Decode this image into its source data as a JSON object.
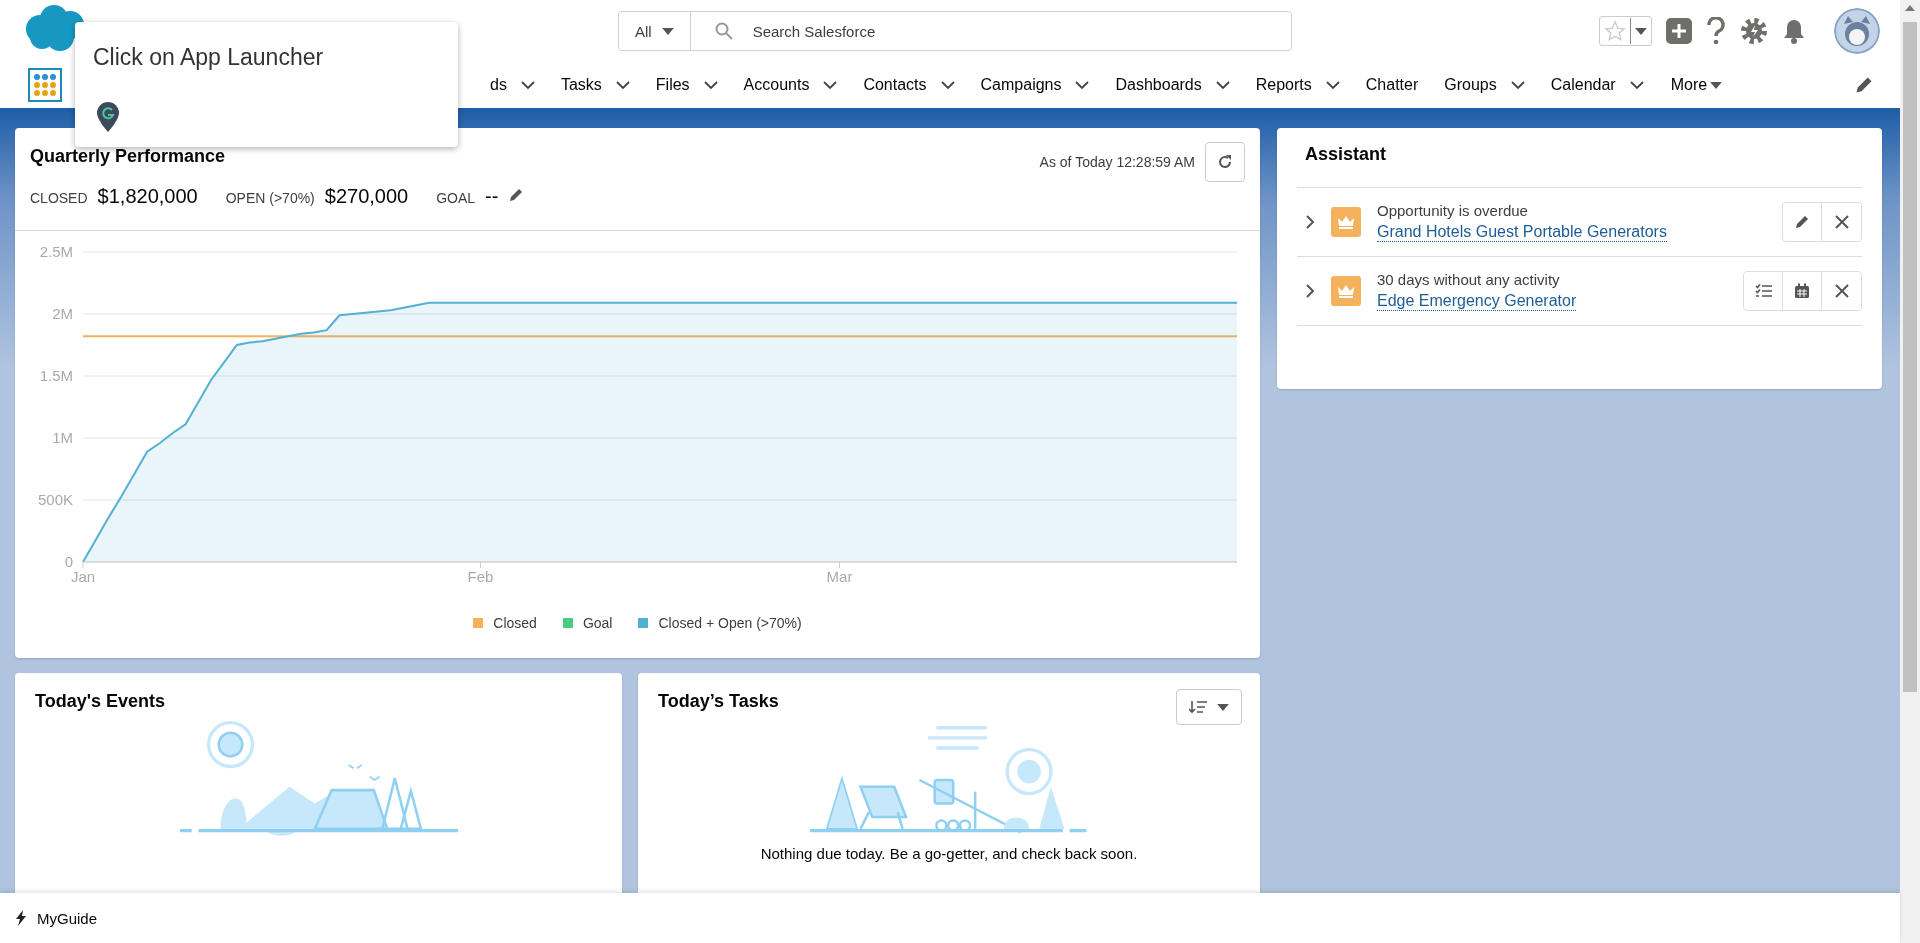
{
  "search": {
    "scope": "All",
    "placeholder": "Search Salesforce"
  },
  "nav": {
    "items": [
      {
        "label": "ds",
        "has_menu": true
      },
      {
        "label": "Tasks",
        "has_menu": true
      },
      {
        "label": "Files",
        "has_menu": true
      },
      {
        "label": "Accounts",
        "has_menu": true
      },
      {
        "label": "Contacts",
        "has_menu": true
      },
      {
        "label": "Campaigns",
        "has_menu": true
      },
      {
        "label": "Dashboards",
        "has_menu": true
      },
      {
        "label": "Reports",
        "has_menu": true
      },
      {
        "label": "Chatter",
        "has_menu": false
      },
      {
        "label": "Groups",
        "has_menu": true
      },
      {
        "label": "Calendar",
        "has_menu": true
      }
    ],
    "more": "More"
  },
  "tooltip": {
    "title": "Click on App Launcher"
  },
  "performance": {
    "title": "Quarterly Performance",
    "as_of": "As of Today 12:28:59 AM",
    "metrics": [
      {
        "label": "CLOSED",
        "value": "$1,820,000",
        "editable": false
      },
      {
        "label": "OPEN (>70%)",
        "value": "$270,000",
        "editable": false
      },
      {
        "label": "GOAL",
        "value": "--",
        "editable": true
      }
    ],
    "chart_data": {
      "type": "area",
      "grid": true,
      "legend": "bottom",
      "categories": [
        "Jan",
        null,
        null,
        null,
        null,
        null,
        null,
        null,
        null,
        null,
        null,
        null,
        null,
        null,
        null,
        null,
        null,
        null,
        null,
        null,
        null,
        null,
        null,
        null,
        null,
        null,
        null,
        null,
        null,
        null,
        null,
        "Feb",
        null,
        null,
        null,
        null,
        null,
        null,
        null,
        null,
        null,
        null,
        null,
        null,
        null,
        null,
        null,
        null,
        null,
        null,
        null,
        null,
        null,
        null,
        null,
        null,
        null,
        null,
        null,
        "Mar",
        null,
        null,
        null,
        null,
        null,
        null,
        null,
        null,
        null,
        null,
        null,
        null,
        null,
        null,
        null,
        null,
        null,
        null,
        null,
        null,
        null,
        null,
        null,
        null,
        null,
        null,
        null,
        null,
        null,
        null,
        null
      ],
      "ylim": [
        0,
        2500000
      ],
      "yticks": [
        {
          "value": 0,
          "label": "0"
        },
        {
          "value": 500000,
          "label": "500K"
        },
        {
          "value": 1000000,
          "label": "1M"
        },
        {
          "value": 1500000,
          "label": "1.5M"
        },
        {
          "value": 2000000,
          "label": "2M"
        },
        {
          "value": 2500000,
          "label": "2.5M"
        }
      ],
      "series": [
        {
          "name": "Closed",
          "type": "line",
          "color": "#f4b25d",
          "values": [
            1820000,
            1820000,
            1820000,
            1820000,
            1820000,
            1820000,
            1820000,
            1820000,
            1820000,
            1820000,
            1820000,
            1820000,
            1820000,
            1820000,
            1820000,
            1820000,
            1820000,
            1820000,
            1820000,
            1820000,
            1820000,
            1820000,
            1820000,
            1820000,
            1820000,
            1820000,
            1820000,
            1820000,
            1820000,
            1820000,
            1820000,
            1820000,
            1820000,
            1820000,
            1820000,
            1820000,
            1820000,
            1820000,
            1820000,
            1820000,
            1820000,
            1820000,
            1820000,
            1820000,
            1820000,
            1820000,
            1820000,
            1820000,
            1820000,
            1820000,
            1820000,
            1820000,
            1820000,
            1820000,
            1820000,
            1820000,
            1820000,
            1820000,
            1820000,
            1820000,
            1820000,
            1820000,
            1820000,
            1820000,
            1820000,
            1820000,
            1820000,
            1820000,
            1820000,
            1820000,
            1820000,
            1820000,
            1820000,
            1820000,
            1820000,
            1820000,
            1820000,
            1820000,
            1820000,
            1820000,
            1820000,
            1820000,
            1820000,
            1820000,
            1820000,
            1820000,
            1820000,
            1820000,
            1820000,
            1820000,
            1820000
          ]
        },
        {
          "name": "Goal",
          "color": "#4bca81",
          "values": [
            null,
            null,
            null,
            null,
            null,
            null,
            null,
            null,
            null,
            null,
            null,
            null,
            null,
            null,
            null,
            null,
            null,
            null,
            null,
            null,
            null,
            null,
            null,
            null,
            null,
            null,
            null,
            null,
            null,
            null,
            null,
            null,
            null,
            null,
            null,
            null,
            null,
            null,
            null,
            null,
            null,
            null,
            null,
            null,
            null,
            null,
            null,
            null,
            null,
            null,
            null,
            null,
            null,
            null,
            null,
            null,
            null,
            null,
            null,
            null,
            null,
            null,
            null,
            null,
            null,
            null,
            null,
            null,
            null,
            null,
            null,
            null,
            null,
            null,
            null,
            null,
            null,
            null,
            null,
            null,
            null,
            null,
            null,
            null,
            null,
            null,
            null,
            null,
            null,
            null,
            null
          ]
        },
        {
          "name": "Closed + Open (>70%)",
          "color": "#54b0d2",
          "values": [
            0,
            180000,
            360000,
            530000,
            710000,
            890000,
            960000,
            1040000,
            1110000,
            1290000,
            1470000,
            1610000,
            1750000,
            1770000,
            1780000,
            1800000,
            1820000,
            1840000,
            1850000,
            1870000,
            1990000,
            2000000,
            2010000,
            2020000,
            2030000,
            2050000,
            2070000,
            2090000,
            2090000,
            2090000,
            2090000,
            2090000,
            2090000,
            2090000,
            2090000,
            2090000,
            2090000,
            2090000,
            2090000,
            2090000,
            2090000,
            2090000,
            2090000,
            2090000,
            2090000,
            2090000,
            2090000,
            2090000,
            2090000,
            2090000,
            2090000,
            2090000,
            2090000,
            2090000,
            2090000,
            2090000,
            2090000,
            2090000,
            2090000,
            2090000,
            2090000,
            2090000,
            2090000,
            2090000,
            2090000,
            2090000,
            2090000,
            2090000,
            2090000,
            2090000,
            2090000,
            2090000,
            2090000,
            2090000,
            2090000,
            2090000,
            2090000,
            2090000,
            2090000,
            2090000,
            2090000,
            2090000,
            2090000,
            2090000,
            2090000,
            2090000,
            2090000,
            2090000,
            2090000,
            2090000,
            2090000
          ]
        }
      ]
    }
  },
  "assistant": {
    "title": "Assistant",
    "items": [
      {
        "reason": "Opportunity is overdue",
        "link": "Grand Hotels Guest Portable Generators",
        "actions": [
          {
            "kind": "edit"
          },
          {
            "kind": "close"
          }
        ]
      },
      {
        "reason": "30 days without any activity",
        "link": "Edge Emergency Generator",
        "actions": [
          {
            "kind": "task"
          },
          {
            "kind": "calendar"
          },
          {
            "kind": "close"
          }
        ]
      }
    ]
  },
  "events": {
    "title": "Today's Events"
  },
  "tasks": {
    "title": "Today’s Tasks",
    "empty_text": "Nothing due today. Be a go-getter, and check back soon."
  },
  "footer": {
    "label": "MyGuide"
  }
}
